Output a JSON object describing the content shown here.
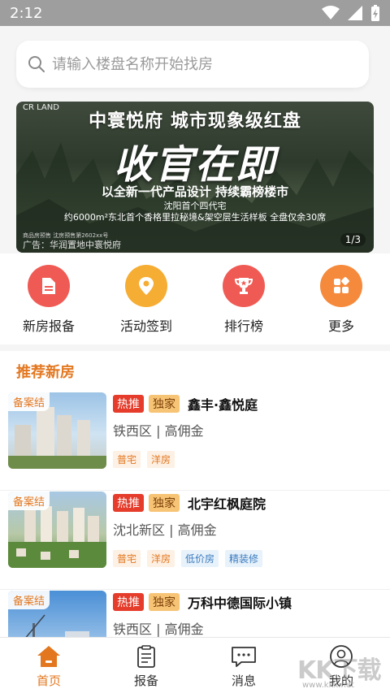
{
  "status": {
    "time": "2:12"
  },
  "search": {
    "placeholder": "请输入楼盘名称开始找房"
  },
  "banner": {
    "logo": "CR LAND",
    "title": "中寰悦府 城市现象级红盘",
    "slogan": "收官在即",
    "line1": "以全新一代产品设计 持续霸榜楼市",
    "line2": "沈阳首个四代宅",
    "line3": "约6000m²东北首个香格里拉秘境&架空层生活样板 全盘仅余30席",
    "tiny": "商品房预售 沈房预售第2602xx号",
    "ad": "广告：华润置地中寰悦府",
    "page": "1/3"
  },
  "quick": [
    {
      "label": "新房报备",
      "icon": "file-icon",
      "color": "#f05a54"
    },
    {
      "label": "活动签到",
      "icon": "location-pin-icon",
      "color": "#f6ad33"
    },
    {
      "label": "排行榜",
      "icon": "trophy-icon",
      "color": "#f05a54"
    },
    {
      "label": "更多",
      "icon": "grid-icon",
      "color": "#f68a3c"
    }
  ],
  "recommend": {
    "title": "推荐新房",
    "houses": [
      {
        "badge": "备案结",
        "hot": "热推",
        "excl": "独家",
        "name": "鑫丰·鑫悦庭",
        "district": "铁西区",
        "commission": "| 高佣金",
        "tags": [
          "普宅",
          "洋房"
        ]
      },
      {
        "badge": "备案结",
        "hot": "热推",
        "excl": "独家",
        "name": "北宇红枫庭院",
        "district": "沈北新区",
        "commission": "| 高佣金",
        "tags": [
          "普宅",
          "洋房",
          "低价房",
          "精装修"
        ]
      },
      {
        "badge": "备案结",
        "hot": "热推",
        "excl": "独家",
        "name": "万科中德国际小镇",
        "district": "铁西区",
        "commission": "| 高佣金",
        "tags": []
      }
    ]
  },
  "tabs": [
    {
      "label": "首页",
      "icon": "home-icon",
      "active": true
    },
    {
      "label": "报备",
      "icon": "clipboard-icon",
      "active": false
    },
    {
      "label": "消息",
      "icon": "chat-icon",
      "active": false
    },
    {
      "label": "我的",
      "icon": "user-icon",
      "active": false
    }
  ],
  "watermark": {
    "text": "KK下载",
    "url": "www.kkx.net"
  },
  "colors": {
    "accent": "#e3771f",
    "hot": "#e53c2b",
    "excl": "#f7c476"
  }
}
